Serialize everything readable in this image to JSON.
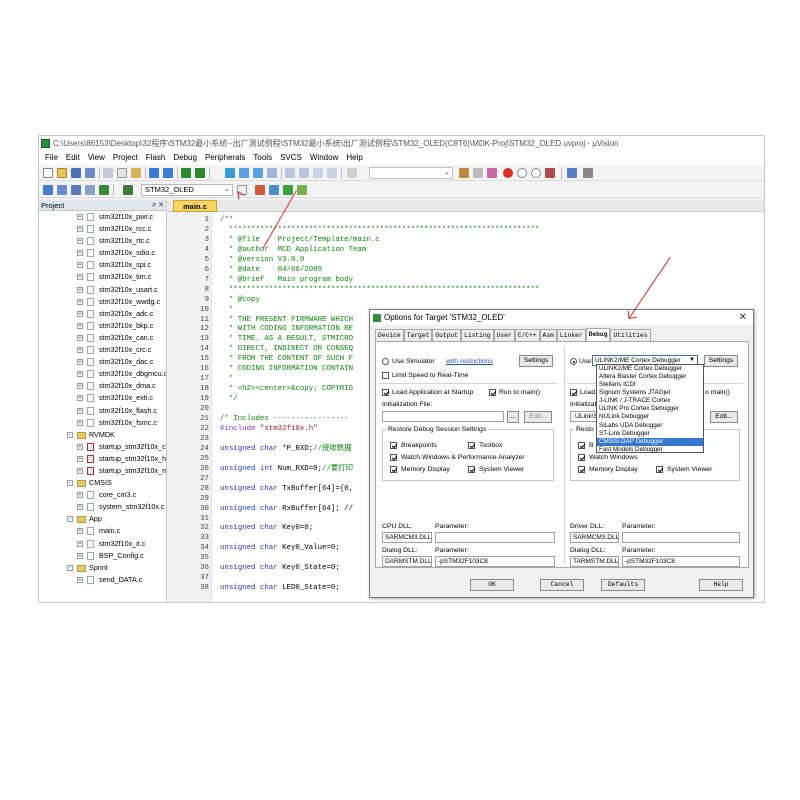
{
  "window": {
    "title": "C:\\Users\\86153\\Desktop\\32程序\\STM32最小系统--出厂测试例程\\STM32最小系统\\出厂测试例程\\STM32_OLED(C8T6)\\MDK-Proj\\STM32_OLED.uvproj - µVision"
  },
  "menu": [
    "File",
    "Edit",
    "View",
    "Project",
    "Flash",
    "Debug",
    "Peripherals",
    "Tools",
    "SVCS",
    "Window",
    "Help"
  ],
  "toolbar": {
    "target": "STM32_OLED"
  },
  "project_panel": {
    "title": "Project",
    "items": [
      {
        "label": "stm32f10x_pwr.c",
        "kind": "file",
        "level": 2
      },
      {
        "label": "stm32f10x_rcc.c",
        "kind": "file",
        "level": 2
      },
      {
        "label": "stm32f10x_rtc.c",
        "kind": "file",
        "level": 2
      },
      {
        "label": "stm32f10x_sdio.c",
        "kind": "file",
        "level": 2
      },
      {
        "label": "stm32f10x_spi.c",
        "kind": "file",
        "level": 2
      },
      {
        "label": "stm32f10x_tim.c",
        "kind": "file",
        "level": 2
      },
      {
        "label": "stm32f10x_usart.c",
        "kind": "file",
        "level": 2
      },
      {
        "label": "stm32f10x_wwdg.c",
        "kind": "file",
        "level": 2
      },
      {
        "label": "stm32f10x_adc.c",
        "kind": "file",
        "level": 2
      },
      {
        "label": "stm32f10x_bkp.c",
        "kind": "file",
        "level": 2
      },
      {
        "label": "stm32f10x_can.c",
        "kind": "file",
        "level": 2
      },
      {
        "label": "stm32f10x_crc.c",
        "kind": "file",
        "level": 2
      },
      {
        "label": "stm32f10x_dac.c",
        "kind": "file",
        "level": 2
      },
      {
        "label": "stm32f10x_dbgmcu.c",
        "kind": "file",
        "level": 2
      },
      {
        "label": "stm32f10x_dma.c",
        "kind": "file",
        "level": 2
      },
      {
        "label": "stm32f10x_exti.c",
        "kind": "file",
        "level": 2
      },
      {
        "label": "stm32f10x_flash.c",
        "kind": "file",
        "level": 2
      },
      {
        "label": "stm32f10x_fsmc.c",
        "kind": "file",
        "level": 2
      },
      {
        "label": "RVMDK",
        "kind": "folder",
        "level": 1
      },
      {
        "label": "startup_stm32f10x_cl.s",
        "kind": "asm",
        "level": 2
      },
      {
        "label": "startup_stm32f10x_hd.s",
        "kind": "asm",
        "level": 2
      },
      {
        "label": "startup_stm32f10x_md.s",
        "kind": "asm",
        "level": 2
      },
      {
        "label": "CMSIS",
        "kind": "folder",
        "level": 1
      },
      {
        "label": "core_cm3.c",
        "kind": "file",
        "level": 2
      },
      {
        "label": "system_stm32f10x.c",
        "kind": "file",
        "level": 2
      },
      {
        "label": "App",
        "kind": "folder",
        "level": 1
      },
      {
        "label": "main.c",
        "kind": "file",
        "level": 2
      },
      {
        "label": "stm32f10x_it.c",
        "kind": "file",
        "level": 2
      },
      {
        "label": "BSP_Config.c",
        "kind": "file",
        "level": 2
      },
      {
        "label": "Sprint",
        "kind": "folder",
        "level": 1
      },
      {
        "label": "send_DATA.c",
        "kind": "file",
        "level": 2
      }
    ]
  },
  "editor": {
    "tab": "main.c",
    "lines": [
      {
        "n": "1",
        "parts": [
          {
            "t": "/**",
            "c": "cm"
          }
        ]
      },
      {
        "n": "2",
        "parts": [
          {
            "t": "  **********************************************************************",
            "c": "cm"
          }
        ]
      },
      {
        "n": "3",
        "parts": [
          {
            "t": "  * @file    Project/Template/main.c",
            "c": "cm"
          }
        ]
      },
      {
        "n": "4",
        "parts": [
          {
            "t": "  * @author  MCD Application Team",
            "c": "cm"
          }
        ]
      },
      {
        "n": "5",
        "parts": [
          {
            "t": "  * @version V3.0.0",
            "c": "cm"
          }
        ]
      },
      {
        "n": "6",
        "parts": [
          {
            "t": "  * @date    04/06/2009",
            "c": "cm"
          }
        ]
      },
      {
        "n": "7",
        "parts": [
          {
            "t": "  * @brief   Main program body",
            "c": "cm"
          }
        ]
      },
      {
        "n": "8",
        "parts": [
          {
            "t": "  **********************************************************************",
            "c": "cm"
          }
        ]
      },
      {
        "n": "9",
        "parts": [
          {
            "t": "  * @copy",
            "c": "cm"
          }
        ]
      },
      {
        "n": "10",
        "parts": [
          {
            "t": "  *",
            "c": "cm"
          }
        ]
      },
      {
        "n": "11",
        "parts": [
          {
            "t": "  * THE PRESENT FIRMWARE WHICH",
            "c": "cm"
          }
        ]
      },
      {
        "n": "12",
        "parts": [
          {
            "t": "  * WITH CODING INFORMATION RE",
            "c": "cm"
          }
        ]
      },
      {
        "n": "13",
        "parts": [
          {
            "t": "  * TIME. AS A RESULT, STMICRO",
            "c": "cm"
          }
        ]
      },
      {
        "n": "14",
        "parts": [
          {
            "t": "  * DIRECT, INDIRECT OR CONSEQ",
            "c": "cm"
          }
        ]
      },
      {
        "n": "15",
        "parts": [
          {
            "t": "  * FROM THE CONTENT OF SUCH F",
            "c": "cm"
          }
        ]
      },
      {
        "n": "16",
        "parts": [
          {
            "t": "  * CODING INFORMATION CONTAIN",
            "c": "cm"
          }
        ]
      },
      {
        "n": "17",
        "parts": [
          {
            "t": "  *",
            "c": "cm"
          }
        ]
      },
      {
        "n": "18",
        "parts": [
          {
            "t": "  * <h2><center>&copy; COPYRIG",
            "c": "cm"
          }
        ]
      },
      {
        "n": "19",
        "parts": [
          {
            "t": "  */",
            "c": "cm"
          }
        ]
      },
      {
        "n": "20",
        "parts": []
      },
      {
        "n": "21",
        "parts": [
          {
            "t": "/* Includes -----------------",
            "c": "cm"
          }
        ]
      },
      {
        "n": "22",
        "parts": [
          {
            "t": "#include ",
            "c": "pp"
          },
          {
            "t": "\"stm32f10x.h\"",
            "c": "st"
          }
        ]
      },
      {
        "n": "23",
        "parts": []
      },
      {
        "n": "24",
        "parts": [
          {
            "t": "unsigned char ",
            "c": "kw"
          },
          {
            "t": "*P_RXD;",
            "c": ""
          },
          {
            "t": "//接收数据",
            "c": "cm"
          }
        ]
      },
      {
        "n": "25",
        "parts": []
      },
      {
        "n": "26",
        "parts": [
          {
            "t": "unsigned int ",
            "c": "kw"
          },
          {
            "t": "Num_RXD=0;",
            "c": ""
          },
          {
            "t": "//要打印",
            "c": "cm"
          }
        ]
      },
      {
        "n": "27",
        "parts": []
      },
      {
        "n": "28",
        "parts": [
          {
            "t": "unsigned char ",
            "c": "kw"
          },
          {
            "t": "TxBuffer[64]={0,",
            "c": ""
          }
        ]
      },
      {
        "n": "29",
        "parts": []
      },
      {
        "n": "30",
        "parts": [
          {
            "t": "unsigned char ",
            "c": "kw"
          },
          {
            "t": "RxBuffer[64]; //",
            "c": ""
          }
        ]
      },
      {
        "n": "31",
        "parts": []
      },
      {
        "n": "32",
        "parts": [
          {
            "t": "unsigned char ",
            "c": "kw"
          },
          {
            "t": "Key0=0;",
            "c": ""
          }
        ]
      },
      {
        "n": "33",
        "parts": []
      },
      {
        "n": "34",
        "parts": [
          {
            "t": "unsigned char ",
            "c": "kw"
          },
          {
            "t": "Key0_Value=0;",
            "c": ""
          }
        ]
      },
      {
        "n": "35",
        "parts": []
      },
      {
        "n": "36",
        "parts": [
          {
            "t": "unsigned char ",
            "c": "kw"
          },
          {
            "t": "Key0_State=0;",
            "c": ""
          }
        ]
      },
      {
        "n": "37",
        "parts": []
      },
      {
        "n": "38",
        "parts": [
          {
            "t": "unsigned char ",
            "c": "kw"
          },
          {
            "t": "LED0_State=0;",
            "c": ""
          }
        ]
      }
    ]
  },
  "dialog": {
    "title": "Options for Target 'STM32_OLED'",
    "tabs": [
      "Device",
      "Target",
      "Output",
      "Listing",
      "User",
      "C/C++",
      "Asm",
      "Linker",
      "Debug",
      "Utilities"
    ],
    "active_tab": "Debug",
    "left": {
      "use_simulator": "Use Simulator",
      "with_restrictions": "with restrictions",
      "settings": "Settings",
      "limit_speed": "Limit Speed to Real-Time",
      "load_app": "Load Application at Startup",
      "run_to_main": "Run to main()",
      "init_file": "Initialization File:",
      "edit": "Edit...",
      "browse": "...",
      "restore_group": "Restore Debug Session Settings",
      "breakpoints": "Breakpoints",
      "toolbox": "Toolbox",
      "watch_windows": "Watch Windows & Performance Analyzer",
      "memory_display": "Memory Display",
      "system_viewer": "System Viewer",
      "cpu_dll_label": "CPU DLL:",
      "cpu_param_label": "Parameter:",
      "cpu_dll": "SARMCM3.DLL",
      "cpu_param": "",
      "dialog_dll_label": "Dialog DLL:",
      "dialog_param_label": "Parameter:",
      "dialog_dll": "DARMSTM.DLL",
      "dialog_param": "-pSTM32F103C8"
    },
    "right": {
      "use": "Use:",
      "selected_debugger": "ULINK2/ME Cortex Debugger",
      "settings": "Settings",
      "load_app_partial": "Load",
      "run_to_main_partial": "o main()",
      "init_partial": "Initializatio",
      "init_value_partial": ".\\JLink\\S",
      "edit": "Edit...",
      "restore_partial": "Resto",
      "breakpoints_partial": "B",
      "watch_windows": "Watch Windows",
      "memory_display": "Memory Display",
      "system_viewer": "System Viewer",
      "driver_dll_label": "Driver DLL:",
      "driver_param_label": "Parameter:",
      "driver_dll": "SARMCM3.DLL",
      "driver_param": "",
      "dialog_dll_label": "Dialog DLL:",
      "dialog_param_label": "Parameter:",
      "dialog_dll": "TARMSTM.DLL",
      "dialog_param": "-pSTM32F103C8"
    },
    "debuggers": [
      {
        "label": "ULINK2/ME Cortex Debugger",
        "selected": false
      },
      {
        "label": "Altera Blaster Cortex Debugger",
        "selected": false
      },
      {
        "label": "Stellaris ICDI",
        "selected": false
      },
      {
        "label": "Signum Systems JTAGjet",
        "selected": false
      },
      {
        "label": "J-LINK / J-TRACE Cortex",
        "selected": false
      },
      {
        "label": "ULINK Pro Cortex Debugger",
        "selected": false
      },
      {
        "label": "NULink Debugger",
        "selected": false
      },
      {
        "label": "SiLabs UDA Debugger",
        "selected": false
      },
      {
        "label": "ST-Link Debugger",
        "selected": false
      },
      {
        "label": "CMSIS-DAP Debugger",
        "selected": true
      },
      {
        "label": "Fast Models Debugger",
        "selected": false
      }
    ],
    "buttons": {
      "ok": "OK",
      "cancel": "Cancel",
      "defaults": "Defaults",
      "help": "Help"
    }
  },
  "colors": {
    "accent_select": "#3478d0",
    "tab_active": "#f7d560",
    "annotation_arrow": "#d9302c"
  }
}
